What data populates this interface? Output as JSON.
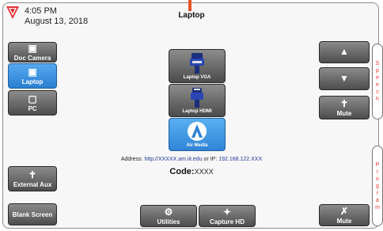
{
  "header": {
    "time": "4:05 PM",
    "date": "August 13, 2018",
    "title": "Laptop"
  },
  "left_panel": {
    "items": [
      {
        "label": "Doc Camera",
        "icon": "image-icon",
        "active": false
      },
      {
        "label": "Laptop",
        "icon": "laptop-icon",
        "active": true
      },
      {
        "label": "PC",
        "icon": "monitor-icon",
        "active": false
      }
    ],
    "external_aux": "External Aux",
    "blank_screen": "Blank Screen"
  },
  "sources": [
    {
      "label": "Laptop VGA",
      "icon": "vga-connector-icon",
      "active": false
    },
    {
      "label": "Laptop HDMI",
      "icon": "hdmi-connector-icon",
      "active": false
    },
    {
      "label": "Air Media",
      "icon": "airmedia-logo-icon",
      "active": true
    }
  ],
  "connection": {
    "address_label": "Address:",
    "address_url": "http://XXXXX.am.iit.edu",
    "or_ip_label": "or IP:",
    "ip": "192.168.122.XXX",
    "code_label": "Code:",
    "code_value": "XXXX"
  },
  "bottom": {
    "utilities": "Utilities",
    "capture_hd": "Capture HD"
  },
  "speech": {
    "vertical_text": [
      "S",
      "p",
      "e",
      "e",
      "c",
      "h"
    ],
    "mute": "Mute"
  },
  "program": {
    "vertical_text": [
      "P",
      "r",
      "o",
      "g",
      "r",
      "a",
      "m"
    ],
    "mute": "Mute"
  },
  "colors": {
    "accent_blue": "#3a8fe0",
    "button_gray": "#6b6b6b",
    "tab_text_red": "#e33333",
    "logo_red": "#e23030"
  }
}
